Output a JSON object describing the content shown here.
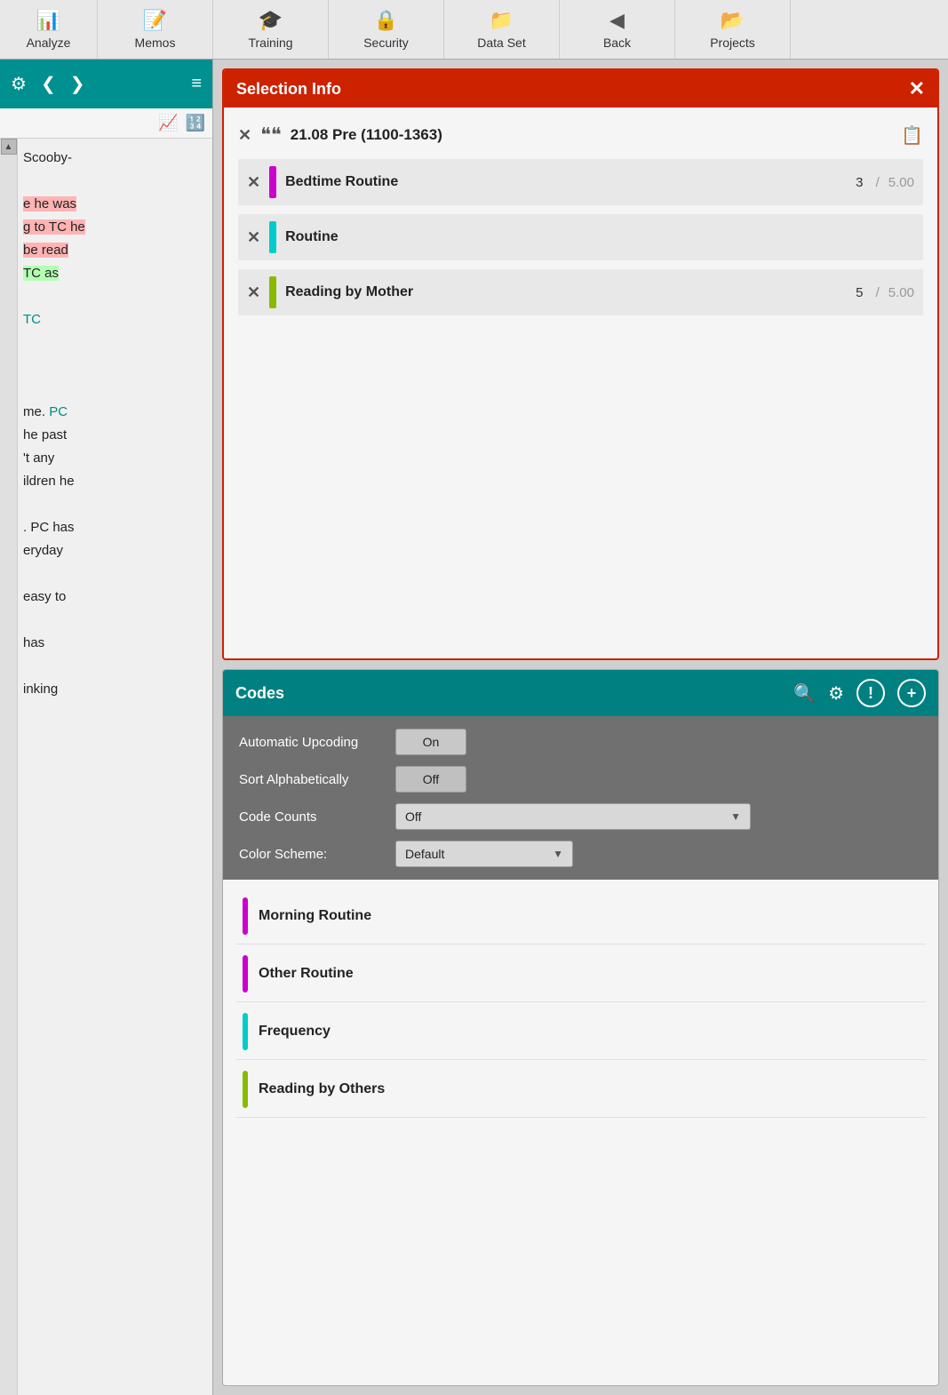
{
  "nav": {
    "items": [
      {
        "id": "analyze",
        "label": "Analyze",
        "icon": "📊"
      },
      {
        "id": "memos",
        "label": "Memos",
        "icon": "📝"
      },
      {
        "id": "training",
        "label": "Training",
        "icon": "🎓"
      },
      {
        "id": "security",
        "label": "Security",
        "icon": "🔒"
      },
      {
        "id": "dataset",
        "label": "Data Set",
        "icon": "📁"
      },
      {
        "id": "back",
        "label": "Back",
        "icon": "◀"
      },
      {
        "id": "projects",
        "label": "Projects",
        "icon": "📂"
      }
    ]
  },
  "left_panel": {
    "text_content": [
      {
        "id": "line1",
        "text": "Scooby-",
        "style": "normal"
      },
      {
        "id": "line2",
        "text": "e he was",
        "style": "pink"
      },
      {
        "id": "line3",
        "text": "g to TC he",
        "style": "pink"
      },
      {
        "id": "line4",
        "text": "be read",
        "style": "pink"
      },
      {
        "id": "line5",
        "text": "TC as",
        "style": "green"
      },
      {
        "id": "line6",
        "text": "",
        "style": "normal"
      },
      {
        "id": "line7",
        "text": "TC",
        "style": "cyan"
      },
      {
        "id": "line8",
        "text": "",
        "style": "normal"
      },
      {
        "id": "line9",
        "text": "me.  PC",
        "style": "normal"
      },
      {
        "id": "line10",
        "text": "he past",
        "style": "normal"
      },
      {
        "id": "line11",
        "text": "'t any",
        "style": "normal"
      },
      {
        "id": "line12",
        "text": "ildren he",
        "style": "normal"
      },
      {
        "id": "line13",
        "text": "",
        "style": "normal"
      },
      {
        "id": "line14",
        "text": ". PC has",
        "style": "normal"
      },
      {
        "id": "line15",
        "text": "eryday",
        "style": "normal"
      },
      {
        "id": "line16",
        "text": "",
        "style": "normal"
      },
      {
        "id": "line17",
        "text": "easy to",
        "style": "normal"
      },
      {
        "id": "line18",
        "text": "",
        "style": "normal"
      },
      {
        "id": "line19",
        "text": "has",
        "style": "normal"
      },
      {
        "id": "line20",
        "text": "",
        "style": "normal"
      },
      {
        "id": "line21",
        "text": "inking",
        "style": "normal"
      }
    ]
  },
  "selection_info": {
    "title": "Selection Info",
    "parent": {
      "label": "21.08 Pre (1100-1363)"
    },
    "children": [
      {
        "id": "bedtime",
        "name": "Bedtime Routine",
        "color": "#cc00cc",
        "count": "3",
        "total": "5.00"
      },
      {
        "id": "routine",
        "name": "Routine",
        "color": "#00cccc",
        "count": null,
        "total": null
      },
      {
        "id": "reading",
        "name": "Reading by Mother",
        "color": "#88bb00",
        "count": "5",
        "total": "5.00"
      }
    ]
  },
  "codes": {
    "title": "Codes",
    "automatic_upcoding": {
      "label": "Automatic Upcoding",
      "value": "On"
    },
    "sort_alphabetically": {
      "label": "Sort Alphabetically",
      "value": "Off"
    },
    "code_counts": {
      "label": "Code Counts",
      "value": "Off"
    },
    "color_scheme": {
      "label": "Color Scheme:",
      "value": "Default"
    },
    "items": [
      {
        "id": "morning",
        "name": "Morning Routine",
        "color": "#cc00cc"
      },
      {
        "id": "other",
        "name": "Other Routine",
        "color": "#cc00cc"
      },
      {
        "id": "frequency",
        "name": "Frequency",
        "color": "#00cccc"
      },
      {
        "id": "reading_others",
        "name": "Reading by Others",
        "color": "#88bb00"
      }
    ]
  }
}
